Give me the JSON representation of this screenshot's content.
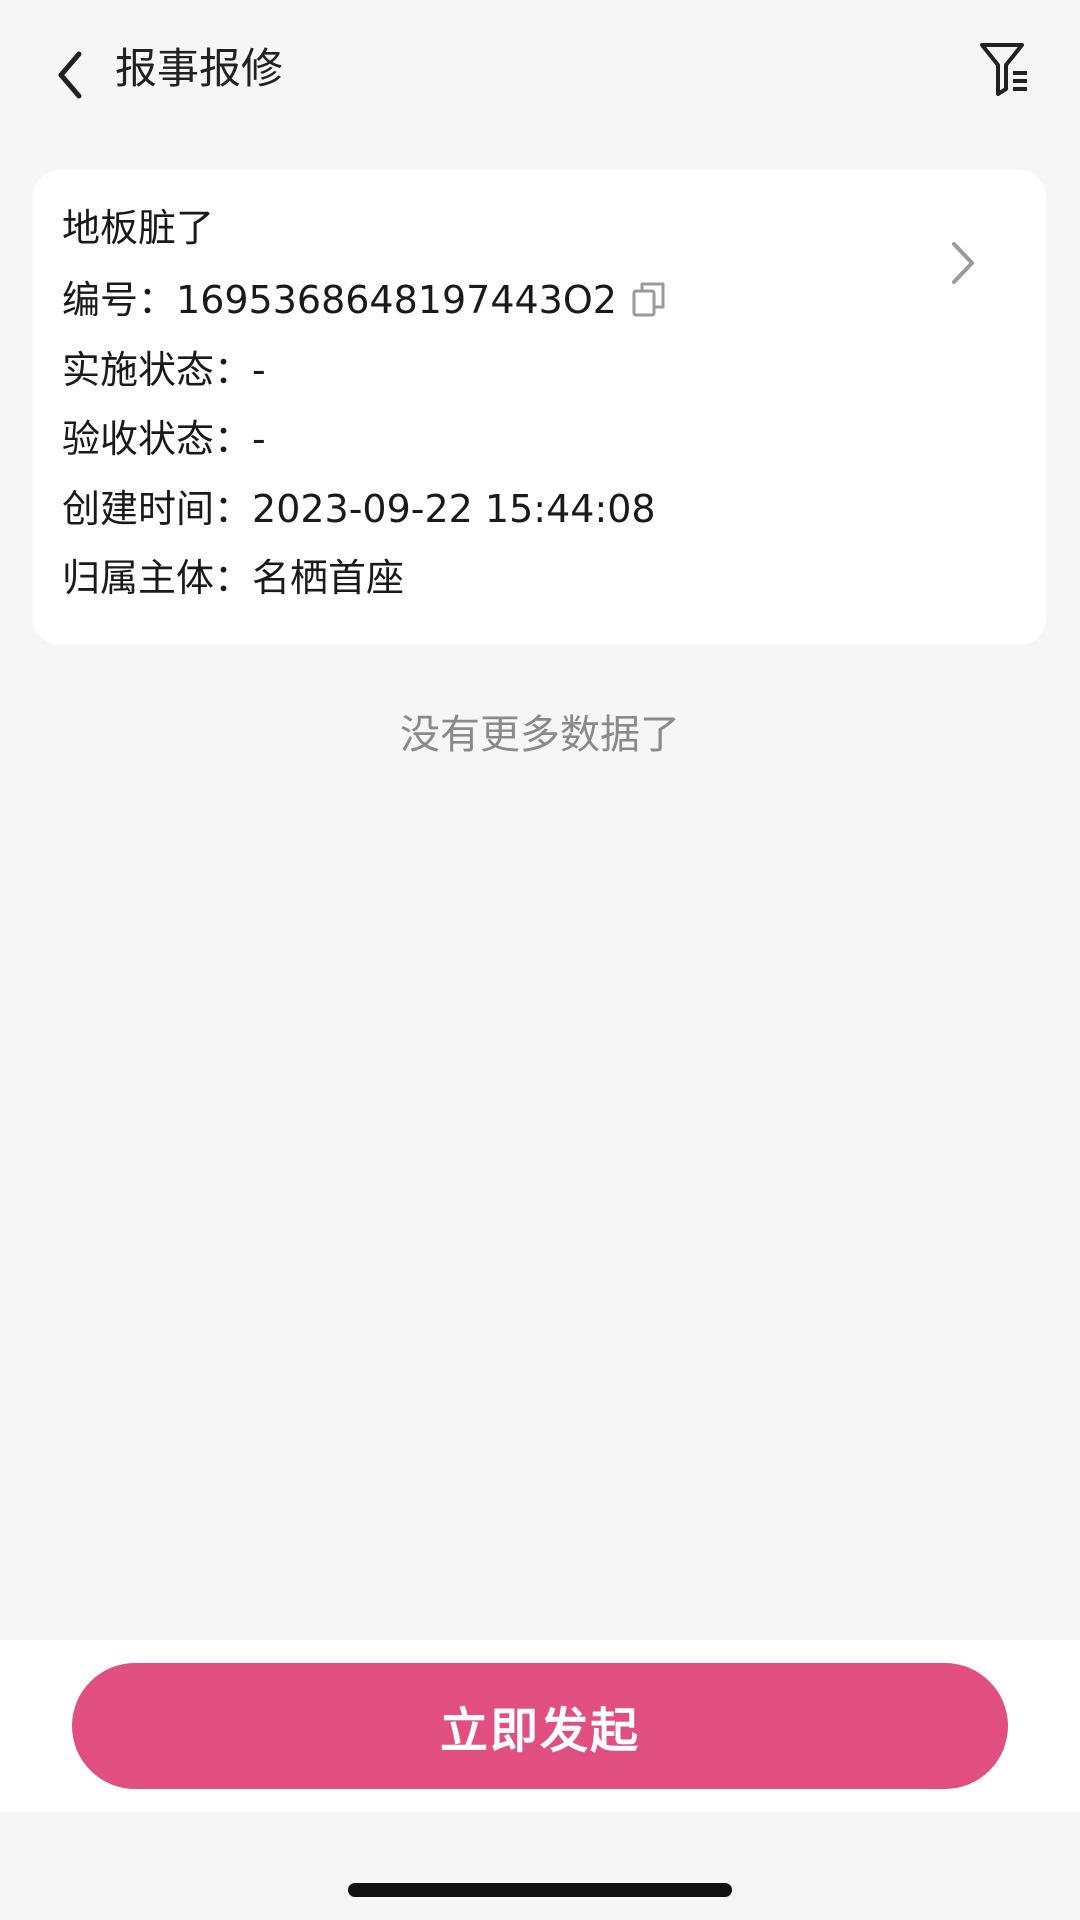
{
  "header": {
    "title": "报事报修",
    "back_icon": "chevron-left-icon",
    "filter_icon": "filter-list-icon"
  },
  "card": {
    "title": "地板脏了",
    "rows": [
      {
        "label": "编号：",
        "value": "1695368648197443O2"
      },
      {
        "label": "实施状态：",
        "value": "-"
      },
      {
        "label": "验收状态：",
        "value": "-"
      },
      {
        "label": "创建时间：",
        "value": "2023-09-22 15:44:08"
      },
      {
        "label": "归属主体：",
        "value": "名栖首座"
      }
    ],
    "copy_icon": "copy-icon",
    "chevron_icon": "chevron-right-icon"
  },
  "list_status": "没有更多数据了",
  "footer": {
    "primary_button": "立即发起",
    "button_color": "#e04f80"
  }
}
